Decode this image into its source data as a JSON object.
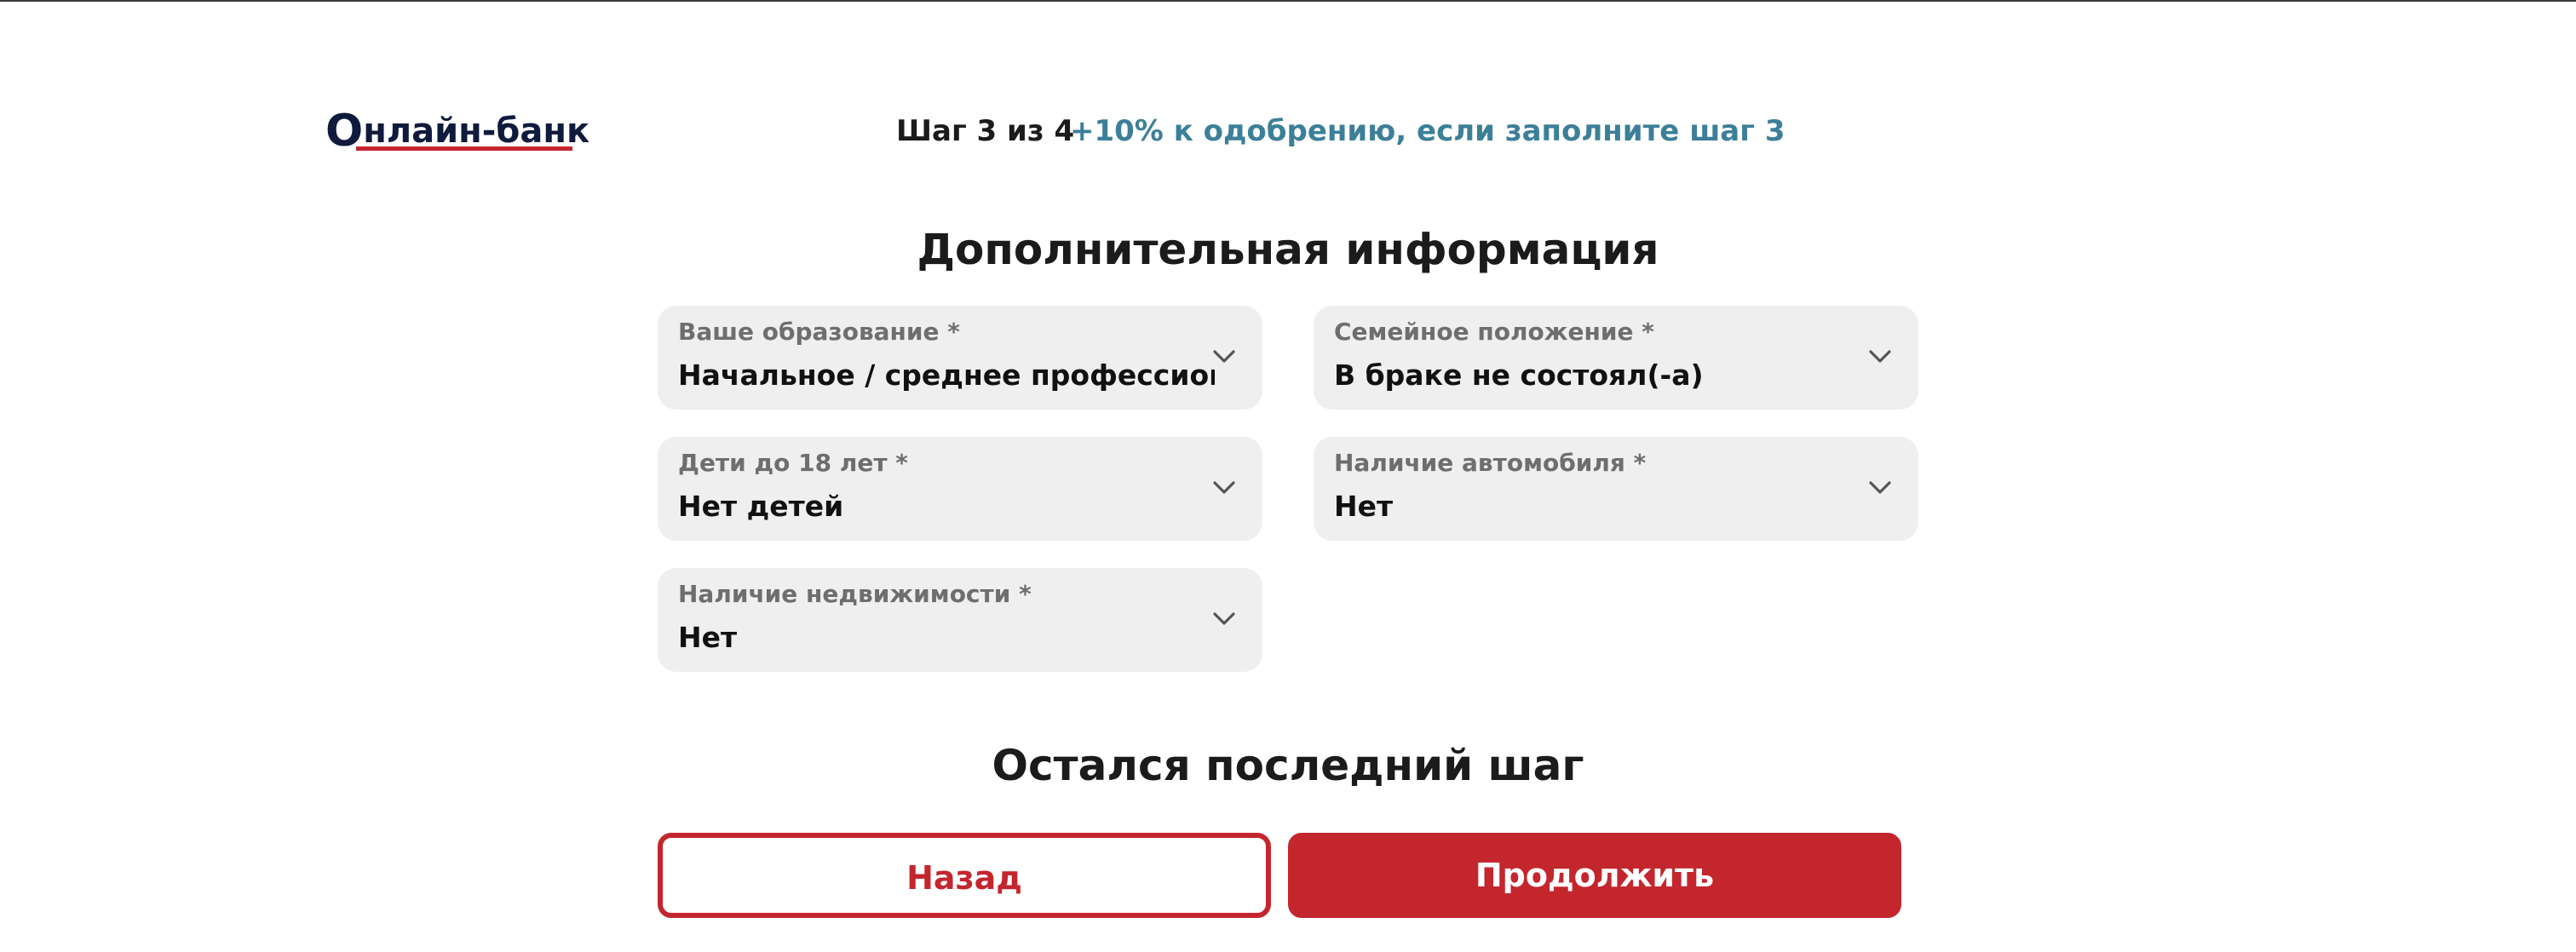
{
  "header": {
    "logo_first": "О",
    "logo_rest": "нлайн-банк",
    "step": "Шаг 3 из 4",
    "bonus": "+10% к одобрению, если заполните шаг 3"
  },
  "form": {
    "title": "Дополнительная информация",
    "fields": {
      "education": {
        "label": "Ваше образование *",
        "value": "Начальное / среднее профессиональное"
      },
      "family": {
        "label": "Семейное положение *",
        "value": "В браке не состоял(-а)"
      },
      "children": {
        "label": "Дети до 18 лет *",
        "value": "Нет детей"
      },
      "car": {
        "label": "Наличие автомобиля *",
        "value": "Нет"
      },
      "property": {
        "label": "Наличие недвижимости *",
        "value": "Нет"
      }
    },
    "chevron_icon": "chevron-down-icon"
  },
  "footer": {
    "title": "Остался последний шаг",
    "back_label": "Назад",
    "next_label": "Продолжить"
  },
  "colors": {
    "brand_red": "#c4262e",
    "accent_teal": "#3c7f98",
    "field_bg": "#eeefee",
    "logo_navy": "#0f1a3c"
  }
}
